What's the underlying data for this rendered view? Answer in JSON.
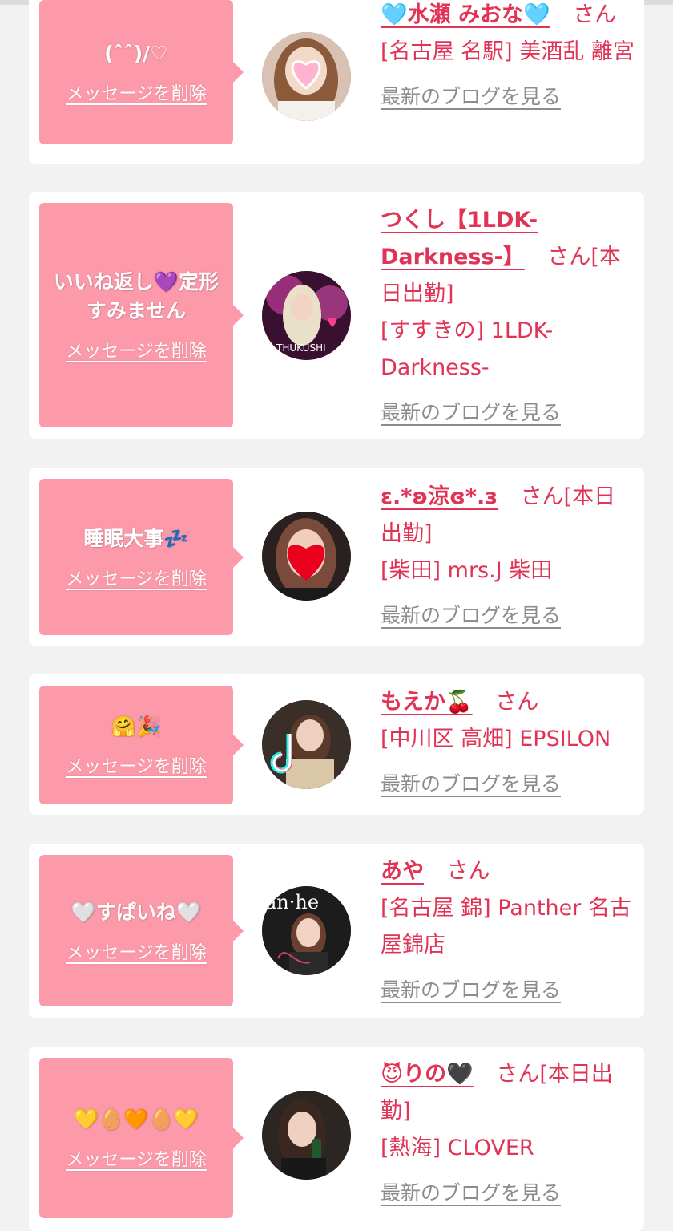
{
  "common": {
    "delete_label": "メッセージを削除",
    "blog_label": "最新のブログを見る",
    "san": "さん"
  },
  "colors": {
    "bubble": "#fd9aaa",
    "accent": "#e03355",
    "link_gray": "#8c8c8c",
    "page_bg": "#f2f2f2"
  },
  "cards": [
    {
      "message": "(ˆˆ)/♡",
      "name": "🩵水瀬 みおな🩵",
      "name_suffix": "さん",
      "shop": "[名古屋 名駅] 美酒乱 離宮"
    },
    {
      "message": "いいね返し💜定形すみません",
      "name": "つくし【1LDK-Darkness-】",
      "name_suffix": "さん[本日出勤]",
      "shop": "[すすきの] 1LDK-Darkness-"
    },
    {
      "message": "睡眠大事💤",
      "name": "ε.*ʚ涼ɞ*.з",
      "name_suffix": "さん[本日出勤]",
      "shop": "[柴田] mrs.J 柴田"
    },
    {
      "message": "🤗🎉",
      "name": "もえか🍒",
      "name_suffix": "さん",
      "shop": "[中川区 高畑] EPSILON"
    },
    {
      "message": "🤍すぱいね🤍",
      "name": "あや",
      "name_suffix": "さん",
      "shop": "[名古屋 錦] Panther 名古屋錦店"
    },
    {
      "message": "💛🥚🧡🥚💛",
      "name": "😈りの🖤",
      "name_suffix": "さん[本日出勤]",
      "shop": "[熱海] CLOVER"
    }
  ]
}
